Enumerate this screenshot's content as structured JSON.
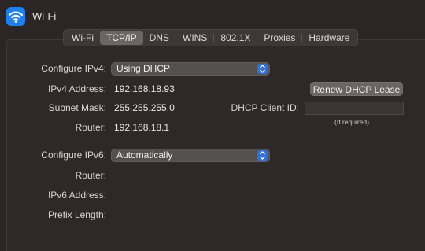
{
  "window": {
    "title": "Wi-Fi",
    "icon": "wifi-icon",
    "accent": "#1e80f5"
  },
  "tabs": [
    {
      "label": "Wi-Fi",
      "active": false
    },
    {
      "label": "TCP/IP",
      "active": true
    },
    {
      "label": "DNS",
      "active": false
    },
    {
      "label": "WINS",
      "active": false
    },
    {
      "label": "802.1X",
      "active": false
    },
    {
      "label": "Proxies",
      "active": false
    },
    {
      "label": "Hardware",
      "active": false
    }
  ],
  "ipv4": {
    "configure_label": "Configure IPv4:",
    "configure_value": "Using DHCP",
    "address_label": "IPv4 Address:",
    "address_value": "192.168.18.93",
    "subnet_label": "Subnet Mask:",
    "subnet_value": "255.255.255.0",
    "router_label": "Router:",
    "router_value": "192.168.18.1",
    "renew_button": "Renew DHCP Lease",
    "client_id_label": "DHCP Client ID:",
    "client_id_value": "",
    "client_id_hint": "(If required)"
  },
  "ipv6": {
    "configure_label": "Configure IPv6:",
    "configure_value": "Automatically",
    "router_label": "Router:",
    "address_label": "IPv6 Address:",
    "prefix_label": "Prefix Length:"
  }
}
